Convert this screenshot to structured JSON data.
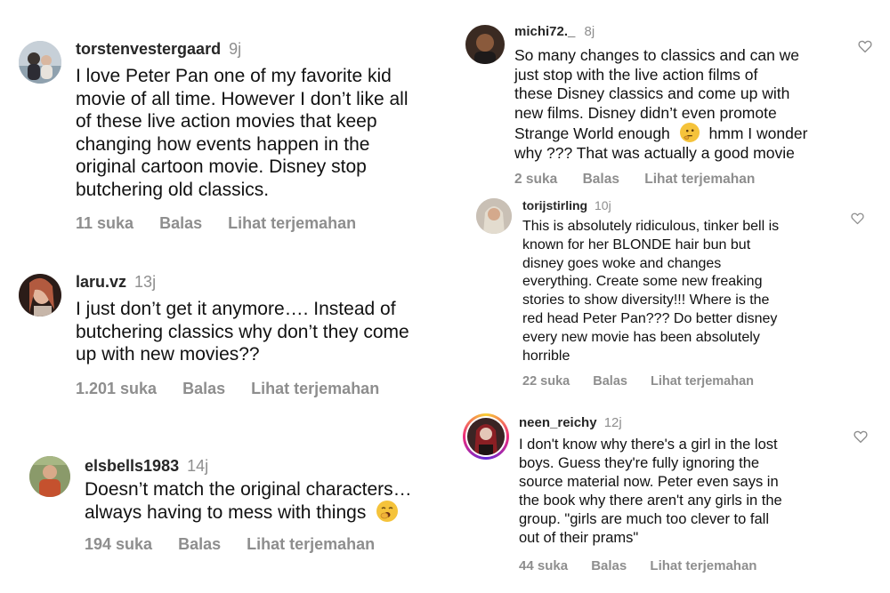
{
  "colors": {
    "meta": "#8e8e8e",
    "text": "#111111",
    "username": "#262626"
  },
  "comments": [
    {
      "username": "torstenvestergaard",
      "age": "9j",
      "lines": [
        "I love Peter Pan one of my favorite kid",
        "movie of all time. However I don’t like all",
        "of these live action movies that keep",
        "changing how events happen in the",
        "original cartoon movie. Disney stop",
        "butchering old classics."
      ],
      "likes": "11 suka",
      "reply": "Balas",
      "translate": "Lihat terjemahan"
    },
    {
      "username": "laru.vz",
      "age": "13j",
      "lines": [
        "I just don’t get it anymore…. Instead of",
        "butchering classics why don’t they come",
        "up with new movies??"
      ],
      "likes": "1.201 suka",
      "reply": "Balas",
      "translate": "Lihat terjemahan"
    },
    {
      "username": "elsbells1983",
      "age": "14j",
      "lines": [
        "Doesn’t match the original characters…",
        "always having to mess with things"
      ],
      "emoji": "yawning-face",
      "likes": "194 suka",
      "reply": "Balas",
      "translate": "Lihat terjemahan"
    },
    {
      "username": "michi72._",
      "age": "8j",
      "lines": [
        "So many changes to classics and can we",
        "just stop with the live action films of",
        "these Disney classics and come up with",
        "new films. Disney didn’t even promote",
        "Strange World enough",
        "hmm I wonder",
        "why ??? That was actually a good movie"
      ],
      "emoji": "thinking-face",
      "likes": "2 suka",
      "reply": "Balas",
      "translate": "Lihat terjemahan"
    },
    {
      "username": "torijstirling",
      "age": "10j",
      "lines": [
        "This is absolutely ridiculous, tinker bell is",
        "known for her BLONDE hair bun but",
        "disney goes woke and changes",
        "everything. Create some new freaking",
        "stories to show diversity!!! Where is the",
        "red head Peter Pan??? Do better disney",
        "every new movie has been absolutely",
        "horrible"
      ],
      "likes": "22 suka",
      "reply": "Balas",
      "translate": "Lihat terjemahan"
    },
    {
      "username": "neen_reichy",
      "age": "12j",
      "lines": [
        "I don't know why there's a girl in the lost",
        "boys. Guess they're fully ignoring the",
        "source material now. Peter even says in",
        "the book why there aren't any girls in the",
        "group. \"girls are much too clever to fall",
        "out of their prams\""
      ],
      "likes": "44 suka",
      "reply": "Balas",
      "translate": "Lihat terjemahan"
    }
  ]
}
